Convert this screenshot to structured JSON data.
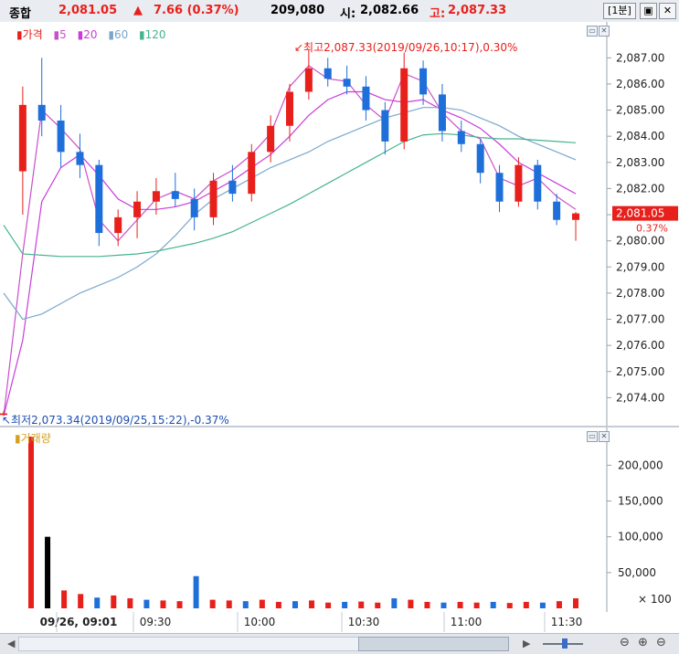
{
  "header": {
    "name": "종합",
    "price": "2,081.05",
    "change_arrow": "▲",
    "change": "7.66 (0.37%)",
    "volume": "209,080",
    "open_label": "시:",
    "open": "2,082.66",
    "high_label": "고:",
    "high": "2,087.33",
    "period": "[1분]",
    "btn_restore": "▣",
    "btn_close": "✕"
  },
  "legend": {
    "price": "가격",
    "ma5": "5",
    "ma20": "20",
    "ma60": "60",
    "ma120": "120",
    "volume": "거래량"
  },
  "annotations": {
    "high": "최고2,087.33(2019/09/26,10:17),0.30%",
    "low": "최저2,073.34(2019/09/25,15:22),-0.37%",
    "current_price": "2,081.05",
    "current_pct": "0.37%"
  },
  "volume_unit": "× 100",
  "colors": {
    "up": "#e8201c",
    "down": "#1e6fd9",
    "ma5": "#c850c8",
    "ma20": "#c83cdc",
    "ma60": "#7aa7cc",
    "ma120": "#46b48c",
    "label_bg": "#e8201c"
  },
  "chart_data": [
    {
      "type": "candlestick",
      "title": "종합 1분",
      "ylim": [
        2073,
        2087.5
      ],
      "yticks": [
        "2,074.00",
        "2,075.00",
        "2,076.00",
        "2,077.00",
        "2,078.00",
        "2,079.00",
        "2,080.00",
        "2,081.00",
        "2,082.00",
        "2,083.00",
        "2,084.00",
        "2,085.00",
        "2,086.00",
        "2,087.00"
      ],
      "xticks": [
        "09/26, 09:01",
        "09:30",
        "10:00",
        "10:30",
        "11:00",
        "11:30"
      ],
      "series": [
        {
          "name": "5",
          "type": "line",
          "values": [
            2073.3,
            2079.5,
            2085.0,
            2084.3,
            2083.5,
            2080.8,
            2080.0,
            2080.8,
            2081.6,
            2081.9,
            2081.6,
            2082.3,
            2082.7,
            2083.3,
            2084.1,
            2085.9,
            2086.7,
            2086.2,
            2086.1,
            2085.2,
            2084.6,
            2086.4,
            2086.1,
            2084.9,
            2084.2,
            2083.9,
            2082.4,
            2082.1,
            2082.4,
            2081.7,
            2081.2
          ]
        },
        {
          "name": "20",
          "type": "line",
          "values": [
            2073.3,
            2076.2,
            2081.5,
            2082.8,
            2083.3,
            2082.5,
            2081.6,
            2081.2,
            2081.2,
            2081.3,
            2081.5,
            2081.9,
            2082.3,
            2082.8,
            2083.3,
            2084.0,
            2084.8,
            2085.4,
            2085.7,
            2085.7,
            2085.4,
            2085.3,
            2085.4,
            2085.0,
            2084.7,
            2084.3,
            2083.7,
            2083.0,
            2082.6,
            2082.2,
            2081.8
          ]
        },
        {
          "name": "60",
          "type": "line",
          "values": [
            2078.0,
            2077.0,
            2077.2,
            2077.6,
            2078.0,
            2078.3,
            2078.6,
            2079.0,
            2079.5,
            2080.2,
            2081.0,
            2081.6,
            2082.0,
            2082.4,
            2082.8,
            2083.1,
            2083.4,
            2083.8,
            2084.1,
            2084.4,
            2084.7,
            2084.9,
            2085.1,
            2085.1,
            2085.0,
            2084.7,
            2084.4,
            2084.0,
            2083.7,
            2083.4,
            2083.1
          ]
        },
        {
          "name": "120",
          "type": "line",
          "values": [
            2080.6,
            2079.5,
            2079.45,
            2079.4,
            2079.4,
            2079.4,
            2079.45,
            2079.5,
            2079.6,
            2079.75,
            2079.9,
            2080.1,
            2080.35,
            2080.7,
            2081.05,
            2081.4,
            2081.8,
            2082.2,
            2082.6,
            2083.0,
            2083.4,
            2083.8,
            2084.05,
            2084.1,
            2084.05,
            2083.95,
            2083.9,
            2083.9,
            2083.85,
            2083.8,
            2083.75
          ]
        }
      ],
      "ohlc": [
        {
          "o": 2073.34,
          "h": 2073.5,
          "l": 2073.34,
          "c": 2073.4
        },
        {
          "o": 2082.66,
          "h": 2085.9,
          "l": 2081.0,
          "c": 2085.2
        },
        {
          "o": 2085.2,
          "h": 2087.0,
          "l": 2084.0,
          "c": 2084.6
        },
        {
          "o": 2084.6,
          "h": 2085.2,
          "l": 2082.8,
          "c": 2083.4
        },
        {
          "o": 2083.4,
          "h": 2084.1,
          "l": 2082.4,
          "c": 2082.9
        },
        {
          "o": 2082.9,
          "h": 2083.1,
          "l": 2079.8,
          "c": 2080.3
        },
        {
          "o": 2080.3,
          "h": 2081.2,
          "l": 2079.8,
          "c": 2080.9
        },
        {
          "o": 2080.9,
          "h": 2081.9,
          "l": 2080.1,
          "c": 2081.5
        },
        {
          "o": 2081.5,
          "h": 2082.4,
          "l": 2081.0,
          "c": 2081.9
        },
        {
          "o": 2081.9,
          "h": 2082.6,
          "l": 2081.3,
          "c": 2081.6
        },
        {
          "o": 2081.6,
          "h": 2082.0,
          "l": 2080.4,
          "c": 2080.9
        },
        {
          "o": 2080.9,
          "h": 2082.6,
          "l": 2080.6,
          "c": 2082.3
        },
        {
          "o": 2082.3,
          "h": 2082.9,
          "l": 2081.5,
          "c": 2081.8
        },
        {
          "o": 2081.8,
          "h": 2083.7,
          "l": 2081.5,
          "c": 2083.4
        },
        {
          "o": 2083.4,
          "h": 2084.8,
          "l": 2083.0,
          "c": 2084.4
        },
        {
          "o": 2084.4,
          "h": 2086.0,
          "l": 2083.8,
          "c": 2085.7
        },
        {
          "o": 2085.7,
          "h": 2087.33,
          "l": 2085.4,
          "c": 2086.6
        },
        {
          "o": 2086.6,
          "h": 2087.0,
          "l": 2085.9,
          "c": 2086.2
        },
        {
          "o": 2086.2,
          "h": 2086.7,
          "l": 2085.6,
          "c": 2085.9
        },
        {
          "o": 2085.9,
          "h": 2086.3,
          "l": 2084.6,
          "c": 2085.0
        },
        {
          "o": 2085.0,
          "h": 2085.3,
          "l": 2083.3,
          "c": 2083.8
        },
        {
          "o": 2083.8,
          "h": 2087.2,
          "l": 2083.5,
          "c": 2086.6
        },
        {
          "o": 2086.6,
          "h": 2086.9,
          "l": 2085.2,
          "c": 2085.6
        },
        {
          "o": 2085.6,
          "h": 2086.0,
          "l": 2083.8,
          "c": 2084.2
        },
        {
          "o": 2084.2,
          "h": 2084.6,
          "l": 2083.4,
          "c": 2083.7
        },
        {
          "o": 2083.7,
          "h": 2083.9,
          "l": 2082.2,
          "c": 2082.6
        },
        {
          "o": 2082.6,
          "h": 2082.9,
          "l": 2081.1,
          "c": 2081.5
        },
        {
          "o": 2081.5,
          "h": 2083.2,
          "l": 2081.3,
          "c": 2082.9
        },
        {
          "o": 2082.9,
          "h": 2083.1,
          "l": 2081.2,
          "c": 2081.5
        },
        {
          "o": 2081.5,
          "h": 2081.8,
          "l": 2080.6,
          "c": 2080.8
        },
        {
          "o": 2080.8,
          "h": 2081.1,
          "l": 2080.0,
          "c": 2081.05
        }
      ]
    },
    {
      "type": "bar",
      "title": "거래량",
      "ylim": [
        0,
        240000
      ],
      "yticks": [
        "50,000",
        "100,000",
        "150,000",
        "200,000"
      ],
      "unit": "× 100",
      "values": [
        240000,
        100000,
        25000,
        20000,
        15000,
        18000,
        14000,
        12000,
        11000,
        10000,
        45000,
        12000,
        11000,
        10000,
        12000,
        9000,
        10000,
        11000,
        8000,
        9000,
        9500,
        8000,
        14000,
        12000,
        9000,
        8000,
        9000,
        8000,
        9000,
        7500,
        9000,
        8000,
        10000,
        14000
      ]
    }
  ]
}
